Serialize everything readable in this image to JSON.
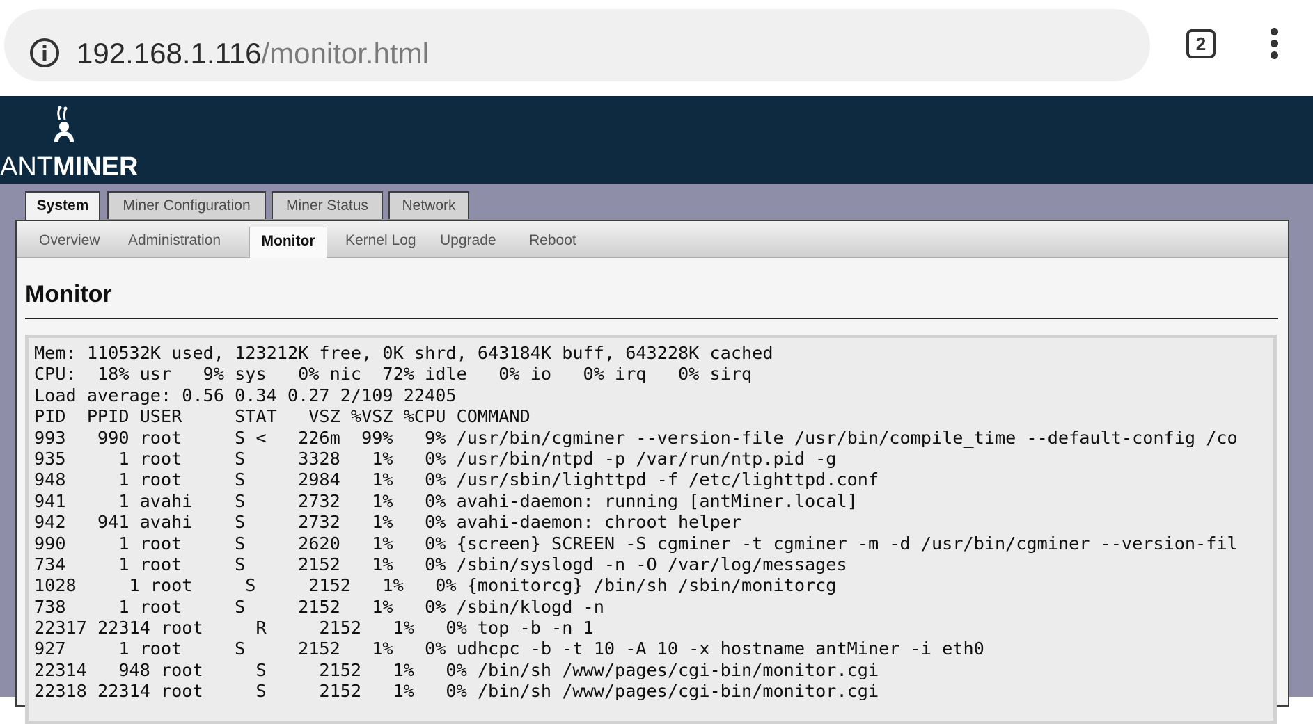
{
  "browser": {
    "url_host": "192.168.1.116",
    "url_path": "/monitor.html",
    "tab_count": "2",
    "icons": [
      "info-icon",
      "tabs-icon",
      "menu-icon"
    ]
  },
  "header": {
    "logo_text_thin": "ANT",
    "logo_text_bold": "MINER"
  },
  "primary_tabs": [
    {
      "label": "System",
      "active": true
    },
    {
      "label": "Miner Configuration",
      "active": false
    },
    {
      "label": "Miner Status",
      "active": false
    },
    {
      "label": "Network",
      "active": false
    }
  ],
  "sub_tabs": [
    {
      "label": "Overview",
      "active": false
    },
    {
      "label": "Administration",
      "active": false
    },
    {
      "label": "Monitor",
      "active": true
    },
    {
      "label": "Kernel Log",
      "active": false
    },
    {
      "label": "Upgrade",
      "active": false
    },
    {
      "label": "Reboot",
      "active": false
    }
  ],
  "page": {
    "title": "Monitor"
  },
  "console": {
    "lines": [
      "Mem: 110532K used, 123212K free, 0K shrd, 643184K buff, 643228K cached",
      "CPU:  18% usr   9% sys   0% nic  72% idle   0% io   0% irq   0% sirq",
      "Load average: 0.56 0.34 0.27 2/109 22405",
      "PID  PPID USER     STAT   VSZ %VSZ %CPU COMMAND",
      "993   990 root     S <   226m  99%   9% /usr/bin/cgminer --version-file /usr/bin/compile_time --default-config /co",
      "935     1 root     S     3328   1%   0% /usr/bin/ntpd -p /var/run/ntp.pid -g",
      "948     1 root     S     2984   1%   0% /usr/sbin/lighttpd -f /etc/lighttpd.conf",
      "941     1 avahi    S     2732   1%   0% avahi-daemon: running [antMiner.local]",
      "942   941 avahi    S     2732   1%   0% avahi-daemon: chroot helper",
      "990     1 root     S     2620   1%   0% {screen} SCREEN -S cgminer -t cgminer -m -d /usr/bin/cgminer --version-fil",
      "734     1 root     S     2152   1%   0% /sbin/syslogd -n -O /var/log/messages",
      "1028     1 root     S     2152   1%   0% {monitorcg} /bin/sh /sbin/monitorcg",
      "738     1 root     S     2152   1%   0% /sbin/klogd -n",
      "22317 22314 root     R     2152   1%   0% top -b -n 1",
      "927     1 root     S     2152   1%   0% udhcpc -b -t 10 -A 10 -x hostname antMiner -i eth0",
      "22314   948 root     S     2152   1%   0% /bin/sh /www/pages/cgi-bin/monitor.cgi",
      "22318 22314 root     S     2152   1%   0% /bin/sh /www/pages/cgi-bin/monitor.cgi"
    ]
  },
  "colors": {
    "header_bg": "#0d2a40",
    "band_bg": "#8f8ea8",
    "console_bg": "#ececec"
  }
}
